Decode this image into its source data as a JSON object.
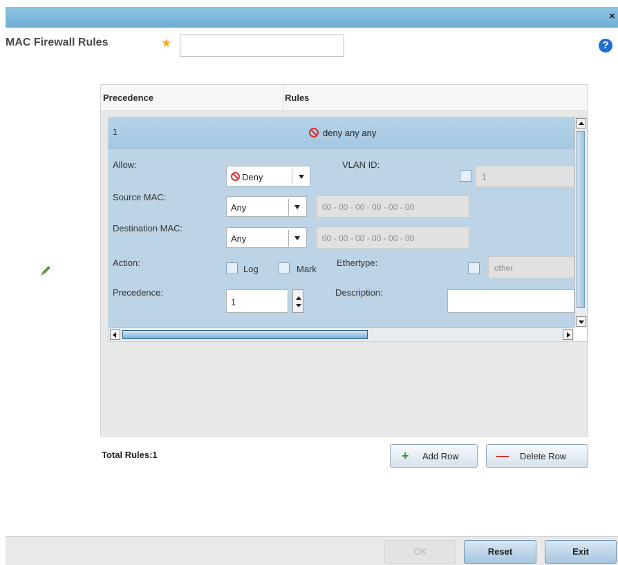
{
  "header": {
    "title": "MAC Firewall Rules",
    "required_star": "★",
    "name_value": "",
    "close_label": "×",
    "help_label": "?"
  },
  "table": {
    "columns": [
      "Precedence",
      "Rules"
    ],
    "rows": [
      {
        "precedence": "1",
        "rule_text": "deny any any"
      }
    ],
    "total_rules_label": "Total Rules:1"
  },
  "row_form": {
    "allow_label": "Allow:",
    "allow_value": "Deny",
    "vlan_label": "VLAN ID:",
    "vlan_value": "1",
    "source_mac_label": "Source MAC:",
    "source_mac_select": "Any",
    "source_mac_value": "00 - 00 - 00 - 00 - 00 - 00",
    "dest_mac_label": "Destination MAC:",
    "dest_mac_select": "Any",
    "dest_mac_value": "00 - 00 - 00 - 00 - 00 - 00",
    "action_label": "Action:",
    "log_label": "Log",
    "mark_label": "Mark",
    "ethertype_label": "Ethertype:",
    "ethertype_value": "other",
    "precedence_label": "Precedence:",
    "precedence_value": "1",
    "description_label": "Description:",
    "description_value": ""
  },
  "buttons": {
    "add_row": "Add Row",
    "delete_row": "Delete Row",
    "add_icon": "+",
    "delete_icon": "—"
  },
  "footer": {
    "ok": "OK",
    "reset": "Reset",
    "exit": "Exit"
  },
  "colors": {
    "title_bar": "#7fb8db",
    "row_header": "#abcbe3",
    "form_bg": "#bcd4e6",
    "deny_red": "#d9302e",
    "add_green": "#2e9b2e",
    "delete_red": "#cc2a2a"
  }
}
